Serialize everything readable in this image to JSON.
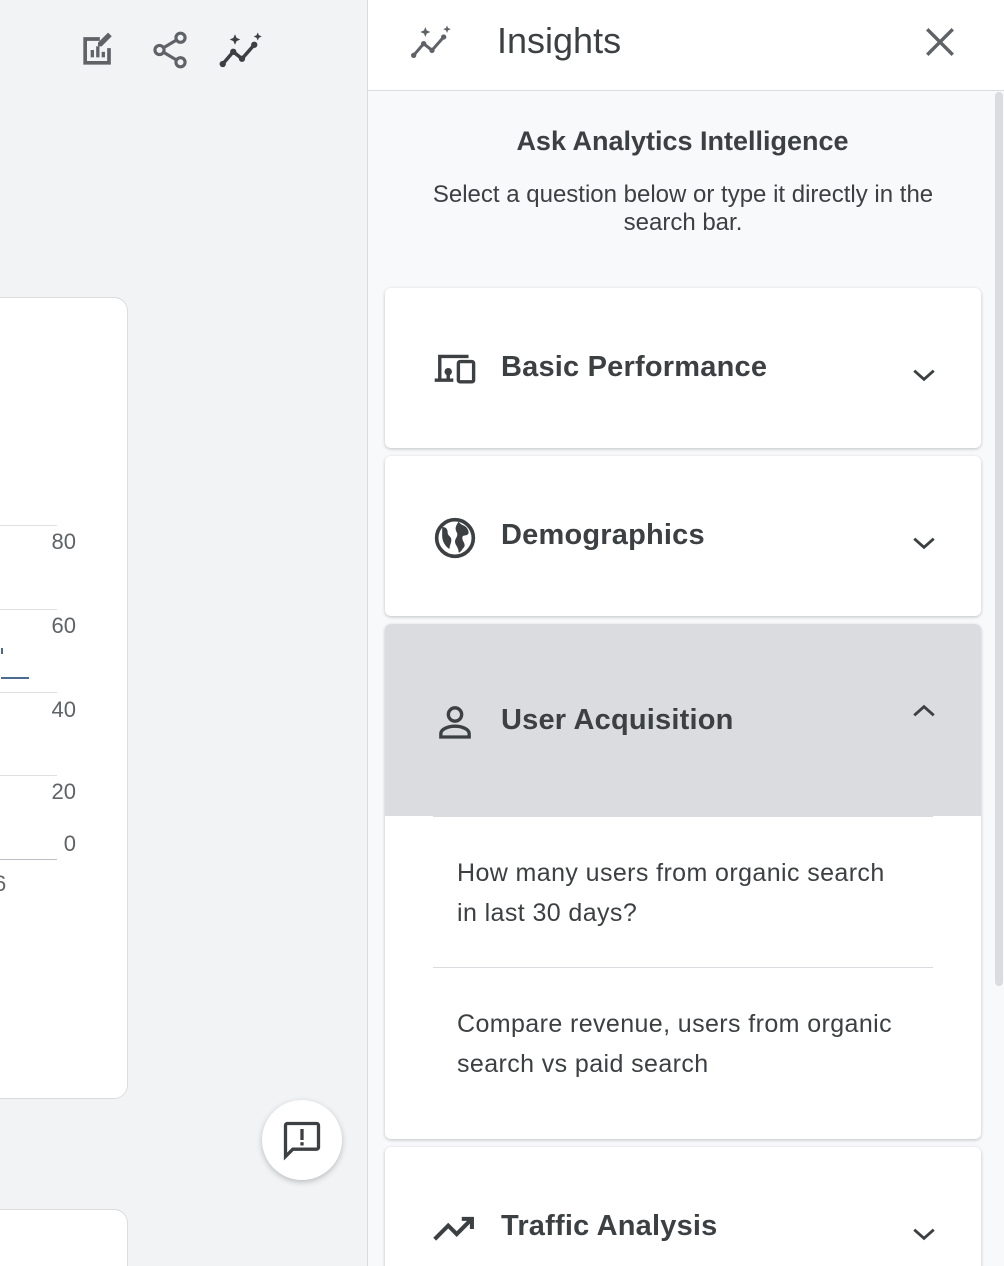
{
  "toolbar": {
    "icons": [
      "edit-report-icon",
      "share-icon",
      "insights-icon"
    ]
  },
  "chart": {
    "y_ticks": [
      "80",
      "60",
      "40",
      "20",
      "0"
    ],
    "x_tick_partial": "6"
  },
  "panel": {
    "title": "Insights",
    "intro_title": "Ask Analytics Intelligence",
    "intro_subtitle": "Select a question below or type it directly in the search bar.",
    "sections": [
      {
        "label": "Basic Performance",
        "icon": "devices-icon",
        "expanded": false
      },
      {
        "label": "Demographics",
        "icon": "globe-icon",
        "expanded": false
      },
      {
        "label": "User Acquisition",
        "icon": "person-icon",
        "expanded": true,
        "questions": [
          "How many users from organic search in last 30 days?",
          "Compare revenue, users from organic search vs paid search"
        ]
      },
      {
        "label": "Traffic Analysis",
        "icon": "trending-up-icon",
        "expanded": false
      }
    ]
  },
  "colors": {
    "accent_line": "#4d6a8f",
    "expanded_header": "#dadce0"
  }
}
